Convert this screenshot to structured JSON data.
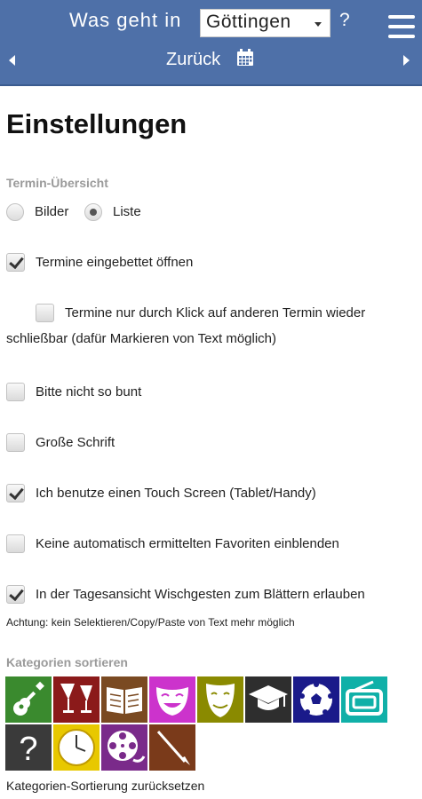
{
  "header": {
    "prefix": "Was geht in",
    "city": "Göttingen",
    "help": "?",
    "back_label": "Zurück"
  },
  "page": {
    "title": "Einstellungen"
  },
  "overview": {
    "heading": "Termin-Übersicht",
    "options": [
      {
        "label": "Bilder",
        "selected": false
      },
      {
        "label": "Liste",
        "selected": true
      }
    ]
  },
  "settings": [
    {
      "label": "Termine eingebettet öffnen",
      "checked": true
    },
    {
      "label": "Termine nur durch Klick auf anderen Termin wieder schließbar (dafür Markieren von Text möglich)",
      "checked": false
    },
    {
      "label": "Bitte nicht so bunt",
      "checked": false
    },
    {
      "label": "Große Schrift",
      "checked": false
    },
    {
      "label": "Ich benutze einen Touch Screen (Tablet/Handy)",
      "checked": true
    },
    {
      "label": "Keine automatisch ermittelten Favoriten einblenden",
      "checked": false
    },
    {
      "label": "In der Tagesansicht Wischgesten zum Blättern erlauben",
      "checked": true
    }
  ],
  "swipe_note": "Achtung: kein Selektieren/Copy/Paste von Text mehr möglich",
  "categories": {
    "heading": "Kategorien sortieren",
    "tiles": [
      {
        "icon": "guitar-icon",
        "color": "#3a8a2e"
      },
      {
        "icon": "cocktail-glasses-icon",
        "color": "#8b1a1a"
      },
      {
        "icon": "book-icon",
        "color": "#7a4a22"
      },
      {
        "icon": "comedy-mask-icon",
        "color": "#cc33cc"
      },
      {
        "icon": "theater-mask-icon",
        "color": "#8a8a00"
      },
      {
        "icon": "graduation-cap-icon",
        "color": "#2e2e2e"
      },
      {
        "icon": "soccer-ball-icon",
        "color": "#1a1a8a"
      },
      {
        "icon": "radio-icon",
        "color": "#10b0a8"
      },
      {
        "icon": "question-icon",
        "color": "#3a3a3a"
      },
      {
        "icon": "clock-icon",
        "color": "#e8c800"
      },
      {
        "icon": "film-reel-icon",
        "color": "#7a2a8a"
      },
      {
        "icon": "brush-icon",
        "color": "#7a3a1a"
      }
    ],
    "reset_label": "Kategorien-Sortierung zurücksetzen"
  }
}
